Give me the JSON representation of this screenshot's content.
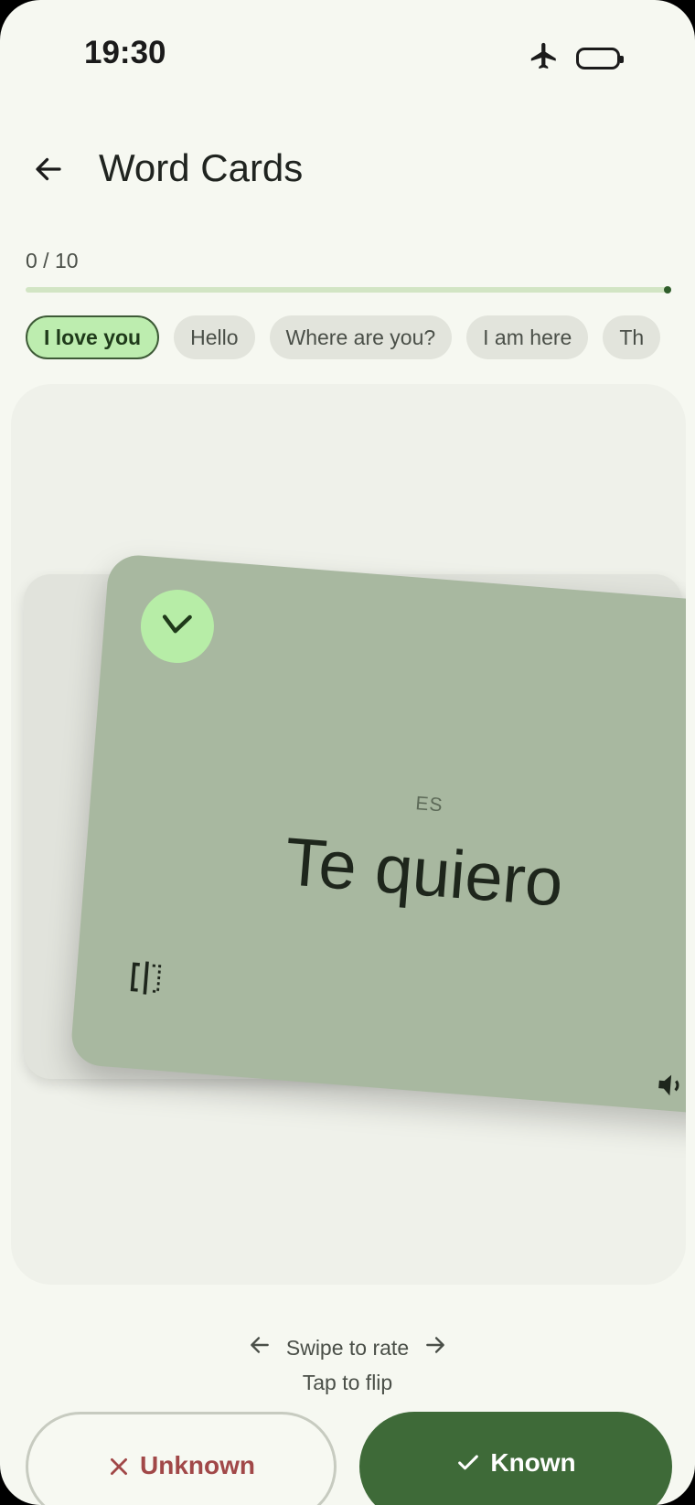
{
  "status_bar": {
    "time": "19:30",
    "icons": [
      "airplane-icon",
      "battery-icon"
    ]
  },
  "header": {
    "back_icon": "arrow-left-icon",
    "title": "Word Cards"
  },
  "progress": {
    "text": "0 / 10",
    "fraction": 0.0
  },
  "chips": [
    {
      "label": "I love you",
      "selected": true
    },
    {
      "label": "Hello",
      "selected": false
    },
    {
      "label": "Where are you?",
      "selected": false
    },
    {
      "label": "I am here",
      "selected": false
    },
    {
      "label": "Th",
      "selected": false
    }
  ],
  "card": {
    "language": "ES",
    "word": "Te quiero",
    "badge_icon": "check-icon",
    "flip_icon": "flip-icon",
    "audio_icon": "speaker-icon"
  },
  "hints": {
    "swipe": "Swipe to rate",
    "tap": "Tap to flip"
  },
  "actions": {
    "unknown_label": "Unknown",
    "known_label": "Known"
  },
  "colors": {
    "accent": "#3e6a38",
    "card": "#a8b8a0",
    "chip_selected": "#bdedaf",
    "unknown": "#a14848"
  }
}
